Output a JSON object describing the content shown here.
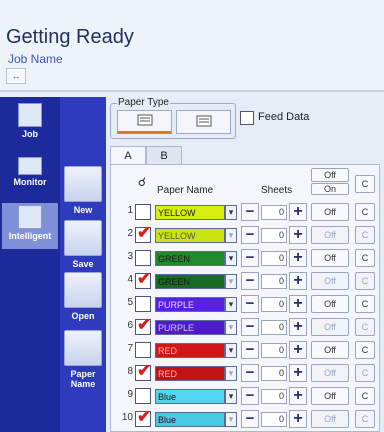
{
  "header": {
    "title": "Getting Ready",
    "job_name": "Job Name",
    "tool_glyph": "↔"
  },
  "nav": {
    "items": [
      {
        "label": "Job",
        "icon": "document-icon",
        "active": false
      },
      {
        "label": "Monitor",
        "icon": "monitor-icon",
        "active": false
      },
      {
        "label": "Intelligent",
        "icon": "intelligent-icon",
        "active": true
      }
    ],
    "tools": [
      {
        "label": "New",
        "icon": "new-file-icon"
      },
      {
        "label": "Save",
        "icon": "save-folder-icon"
      },
      {
        "label": "Open",
        "icon": "open-folder-icon"
      },
      {
        "label": "Paper Name",
        "icon": "paper-name-icon"
      }
    ]
  },
  "paper_type": {
    "label": "Paper Type",
    "selected_index": 0
  },
  "feed_data": {
    "label": "Feed Data",
    "checked": false
  },
  "tabs": [
    {
      "label": "A",
      "active": true
    },
    {
      "label": "B",
      "active": false
    }
  ],
  "table": {
    "col_paper_name": "Paper Name",
    "col_sheets": "Sheets",
    "top_off": "Off",
    "top_on": "On",
    "top_c": "C",
    "rows": [
      {
        "num": "1",
        "checked": false,
        "name": "YELLOW",
        "color": "#d7ee10",
        "text": "#1a1a1a",
        "sheets": "0",
        "state": "Off",
        "c": "C",
        "dim": false
      },
      {
        "num": "2",
        "checked": true,
        "name": "YELLOW",
        "color": "#c9e40e",
        "text": "#555555",
        "sheets": "0",
        "state": "Off",
        "c": "C",
        "dim": true
      },
      {
        "num": "3",
        "checked": false,
        "name": "GREEN",
        "color": "#1f8a2c",
        "text": "#1a1a1a",
        "sheets": "0",
        "state": "Off",
        "c": "C",
        "dim": false
      },
      {
        "num": "4",
        "checked": true,
        "name": "GREEN",
        "color": "#1a6b24",
        "text": "#1a1a1a",
        "sheets": "0",
        "state": "Off",
        "c": "C",
        "dim": true
      },
      {
        "num": "5",
        "checked": false,
        "name": "PURPLE",
        "color": "#5a1fe6",
        "text": "#e0d6ff",
        "sheets": "0",
        "state": "Off",
        "c": "C",
        "dim": false
      },
      {
        "num": "6",
        "checked": true,
        "name": "PURPLE",
        "color": "#4f1ccc",
        "text": "#cfc5f5",
        "sheets": "0",
        "state": "Off",
        "c": "C",
        "dim": true
      },
      {
        "num": "7",
        "checked": false,
        "name": "RED",
        "color": "#d01616",
        "text": "#ffb0b0",
        "sheets": "0",
        "state": "Off",
        "c": "C",
        "dim": false
      },
      {
        "num": "8",
        "checked": true,
        "name": "RED",
        "color": "#c01414",
        "text": "#ffb0b0",
        "sheets": "0",
        "state": "Off",
        "c": "C",
        "dim": true
      },
      {
        "num": "9",
        "checked": false,
        "name": "Blue",
        "color": "#52d6ee",
        "text": "#1a1a1a",
        "sheets": "0",
        "state": "Off",
        "c": "C",
        "dim": false
      },
      {
        "num": "10",
        "checked": true,
        "name": "Blue",
        "color": "#48c8e2",
        "text": "#1a1a1a",
        "sheets": "0",
        "state": "Off",
        "c": "C",
        "dim": true
      }
    ]
  }
}
